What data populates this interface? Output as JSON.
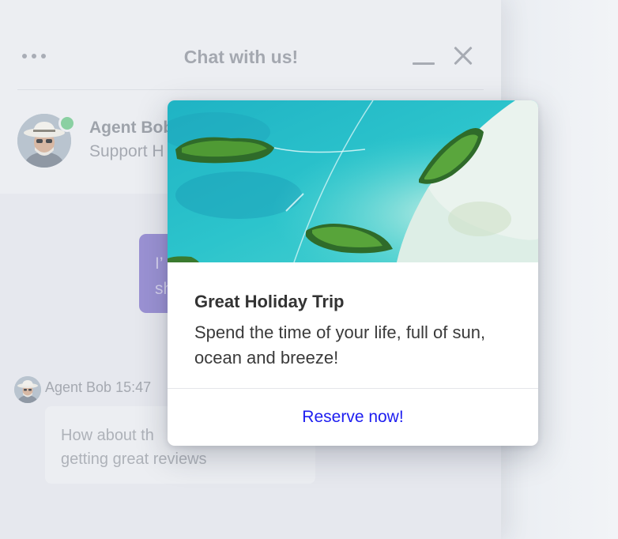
{
  "chat": {
    "title": "Chat with us!",
    "agent": {
      "name": "Agent Bob",
      "role": "Support H",
      "status_color": "#8ad0a2"
    },
    "user_message": {
      "lines": [
        "I’",
        "sh"
      ],
      "bubble_color": "#9b92d4"
    },
    "agent_message": {
      "meta": "Agent Bob 15:47",
      "lines": [
        "How about th",
        "getting great reviews"
      ]
    },
    "icons": {
      "menu": "more-dots-icon",
      "minimize": "minimize-icon",
      "close": "close-icon"
    }
  },
  "promo": {
    "title": "Great Holiday Trip",
    "description": "Spend the time of your life, full of sun, ocean and breeze!",
    "button_label": "Reserve now!",
    "button_color": "#1d1df0",
    "image": "aerial-tropical-islands"
  }
}
